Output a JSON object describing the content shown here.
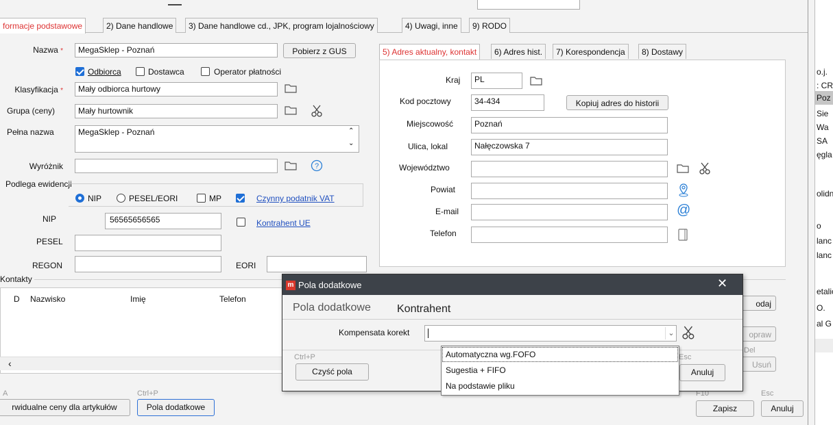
{
  "tabs_main": [
    {
      "label": "formacje podstawowe"
    },
    {
      "label": "2) Dane handlowe"
    },
    {
      "label": "3) Dane handlowe cd., JPK, program lojalnościowy"
    },
    {
      "label": "4) Uwagi, inne"
    },
    {
      "label": "9) RODO"
    }
  ],
  "form": {
    "nazwa_label": "Nazwa",
    "nazwa_value": "MegaSklep - Poznań",
    "pobierz_gus": "Pobierz z GUS",
    "odbiorca": "Odbiorca",
    "dostawca": "Dostawca",
    "operator": "Operator płatności",
    "klasyfikacja_label": "Klasyfikacja",
    "klasyfikacja_value": "Mały odbiorca hurtowy",
    "grupa_label": "Grupa (ceny)",
    "grupa_value": "Mały hurtownik",
    "pelna_label": "Pełna nazwa",
    "pelna_value": "MegaSklep - Poznań",
    "wyroznik_label": "Wyróżnik",
    "podlega_label": "Podlega ewidencji",
    "nip_radio": "NIP",
    "pesel_radio": "PESEL/EORI",
    "mp_check": "MP",
    "czynny_vat": "Czynny podatnik VAT",
    "nip_label": "NIP",
    "nip_value": "56565656565",
    "kontrahent_ue": "Kontrahent UE",
    "pesel_label": "PESEL",
    "regon_label": "REGON",
    "eori_label": "EORI"
  },
  "kontakty": {
    "title": "Kontakty",
    "columns": [
      "D",
      "Nazwisko",
      "Imię",
      "Telefon"
    ]
  },
  "address": {
    "tabs": [
      {
        "label": "5) Adres aktualny, kontakt"
      },
      {
        "label": "6) Adres hist."
      },
      {
        "label": "7) Korespondencja"
      },
      {
        "label": "8) Dostawy"
      }
    ],
    "kraj_label": "Kraj",
    "kraj_value": "PL",
    "kod_label": "Kod pocztowy",
    "kod_value": "34-434",
    "kopiuj": "Kopiuj adres do historii",
    "miejscowosc_label": "Miejscowość",
    "miejscowosc_value": "Poznań",
    "ulica_label": "Ulica, lokal",
    "ulica_value": "Nałęczowska 7",
    "wojewodztwo_label": "Województwo",
    "powiat_label": "Powiat",
    "email_label": "E-mail",
    "telefon_label": "Telefon"
  },
  "right_buttons": {
    "dodaj": "odaj",
    "popraw": "opraw",
    "del_shortcut": "Del",
    "usun": "Usuń"
  },
  "bottom": {
    "shortcut_a": "A",
    "indywidualne": "rwidualne ceny dla artykułów",
    "ctrlp": "Ctrl+P",
    "pola_dodatkowe": "Pola dodatkowe",
    "f10": "F10",
    "zapisz": "Zapisz",
    "esc": "Esc",
    "anuluj": "Anuluj"
  },
  "right_strip": [
    "o.j.",
    ": CR",
    "Poz",
    "Sie",
    "Wa",
    "SA",
    "ęgla",
    "olidn",
    "o",
    "lanc",
    "lanc",
    "etalic",
    "O.",
    "al G"
  ],
  "modal": {
    "title": "Pola dodatkowe",
    "heading1": "Pola dodatkowe",
    "heading2": "Kontrahent",
    "field_label": "Kompensata korekt",
    "field_value": "",
    "ctrlp": "Ctrl+P",
    "czysc": "Czyść pola",
    "esc": "Esc",
    "anuluj": "Anuluj",
    "options": [
      "Automatyczna wg.FOFO",
      "Sugestia + FIFO",
      "Na podstawie pliku"
    ],
    "accent": "#d9372b",
    "titlebar_color": "#3d4249"
  }
}
